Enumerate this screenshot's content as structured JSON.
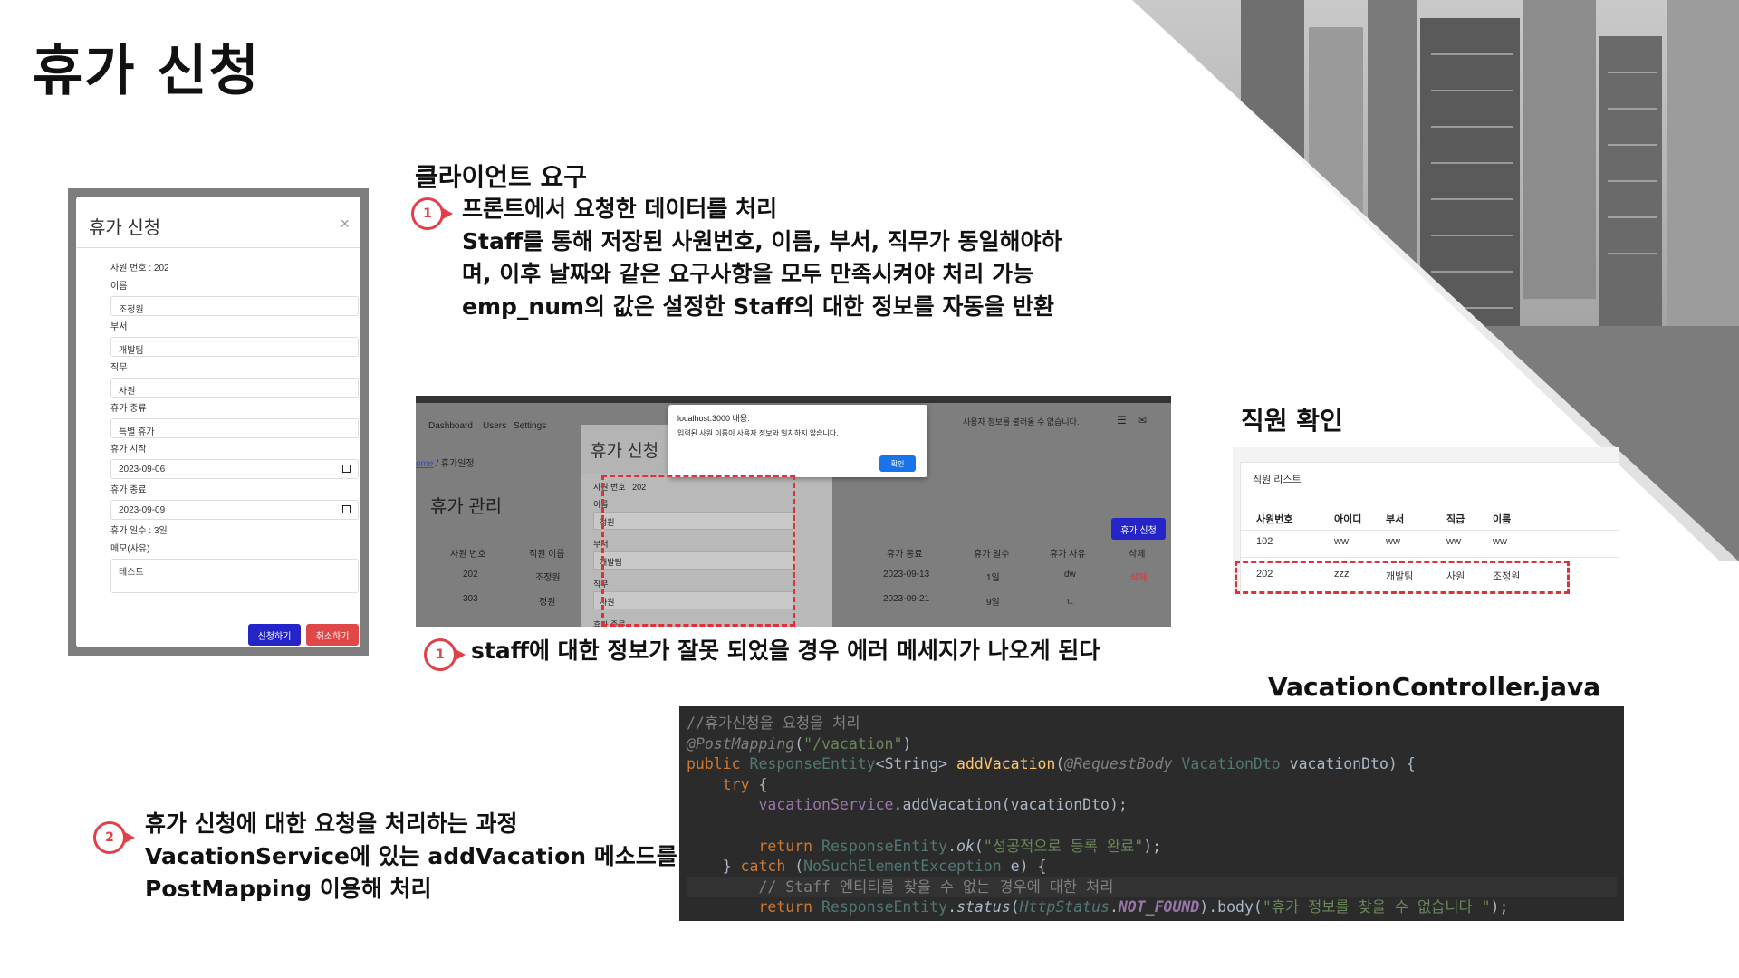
{
  "slide": {
    "title": "휴가 신청"
  },
  "client_request": {
    "heading": "클라이언트 요구",
    "badge": "1",
    "lines": [
      "프론트에서 요청한 데이터를 처리",
      "Staff를 통해 저장된 사원번호, 이름, 부서, 직무가 동일해야하",
      "며, 이후 날짜와 같은 요구사항을 모두 만족시켜야 처리 가능",
      "emp_num의 값은 설정한 Staff의 대한 정보를 자동을 반환"
    ]
  },
  "error_note": {
    "badge": "1",
    "text": "staff에 대한 정보가 잘못 되었을 경우 에러 메세지가 나오게 된다"
  },
  "process_note": {
    "badge": "2",
    "lines": [
      "휴가 신청에 대한 요청을 처리하는 과정",
      "VacationService에 있는 addVacation 메소드를",
      "PostMapping 이용해 처리"
    ]
  },
  "staff_check": {
    "heading": "직원 확인"
  },
  "code_file": {
    "filename": "VacationController.java"
  },
  "vacation_modal": {
    "title": "휴가 신청",
    "close": "×",
    "emp_num": "사원 번호 : 202",
    "name_label": "이름",
    "name_value": "조정원",
    "dept_label": "부서",
    "dept_value": "개발팀",
    "job_label": "직무",
    "job_value": "사원",
    "type_label": "휴가 종류",
    "type_value": "특별 휴가",
    "start_label": "휴가 시작",
    "start_value": "2023-09-06",
    "end_label": "휴가 종료",
    "end_value": "2023-09-09",
    "days": "휴가 일수 : 3일",
    "memo_label": "메모(사유)",
    "memo_value": "테스트",
    "submit": "신청하기",
    "cancel": "취소하기",
    "colors": {
      "submit": "#2424c8",
      "cancel": "#e04848"
    }
  },
  "web_app": {
    "nav": [
      "Dashboard",
      "Users",
      "Settings"
    ],
    "breadcrumb_home": "ome",
    "breadcrumb_sep": "/",
    "breadcrumb_page": "휴가일정",
    "page_title": "휴가 관리",
    "dialog_title": "휴가 신청",
    "top_message": "사용자 정보를 불러올 수 없습니다.",
    "alert_origin": "localhost:3000 내용:",
    "alert_message": "입력된 사원 이름이 사용자 정보와 일치하지 않습니다.",
    "alert_ok": "확인",
    "add_button": "휴가 신청",
    "form": {
      "emp_num": "사원 번호 : 202",
      "name_label": "이름",
      "name_value": "정원",
      "dept_label": "부서",
      "dept_value": "개발팀",
      "job_label": "직무",
      "job_value": "사원",
      "type_label": "휴가 종류"
    },
    "table_headers_left": [
      "사원 번호",
      "직원 이름"
    ],
    "table_headers_right": [
      "휴가 종료",
      "휴가 일수",
      "휴가 사유",
      "삭제"
    ],
    "rows": [
      {
        "emp": "202",
        "name": "조정원",
        "end": "2023-09-13",
        "days": "1일",
        "reason": "dw",
        "del": "삭제"
      },
      {
        "emp": "303",
        "name": "정원",
        "end": "2023-09-21",
        "days": "9일",
        "reason": "ㄴ",
        "del": ""
      }
    ]
  },
  "staff_list": {
    "title": "직원 리스트",
    "headers": [
      "사원번호",
      "아이디",
      "부서",
      "직급",
      "이름"
    ],
    "rows": [
      [
        "102",
        "ww",
        "ww",
        "ww",
        "ww"
      ],
      [
        "202",
        "zzz",
        "개발팀",
        "사원",
        "조정원"
      ]
    ]
  },
  "code": {
    "comment1": "//휴가신청을 요청을 처리",
    "mapping_ann": "@PostMapping",
    "mapping_arg": "\"/vacation\"",
    "kw_public": "public",
    "type_resp": "ResponseEntity",
    "type_string": "String",
    "method_add": "addVacation",
    "ann_body": "@RequestBody",
    "type_dto": "VacationDto",
    "param_dto": "vacationDto",
    "kw_try": "try",
    "svc_field": "vacationService",
    "svc_call": "addVacation",
    "kw_return": "return",
    "ok_method": "ok",
    "ok_msg": "\"성공적으로 등록 완료\"",
    "kw_catch": "catch",
    "type_exc": "NoSuchElementException",
    "var_e": "e",
    "comment2": "// Staff 엔티티를 찾을 수 없는 경우에 대한 처리",
    "status_method": "status",
    "type_http": "HttpStatus",
    "const_nf": "NOT_FOUND",
    "body_method": "body",
    "err_msg": "\"휴가 정보를 찾을 수 없습니다 \""
  }
}
